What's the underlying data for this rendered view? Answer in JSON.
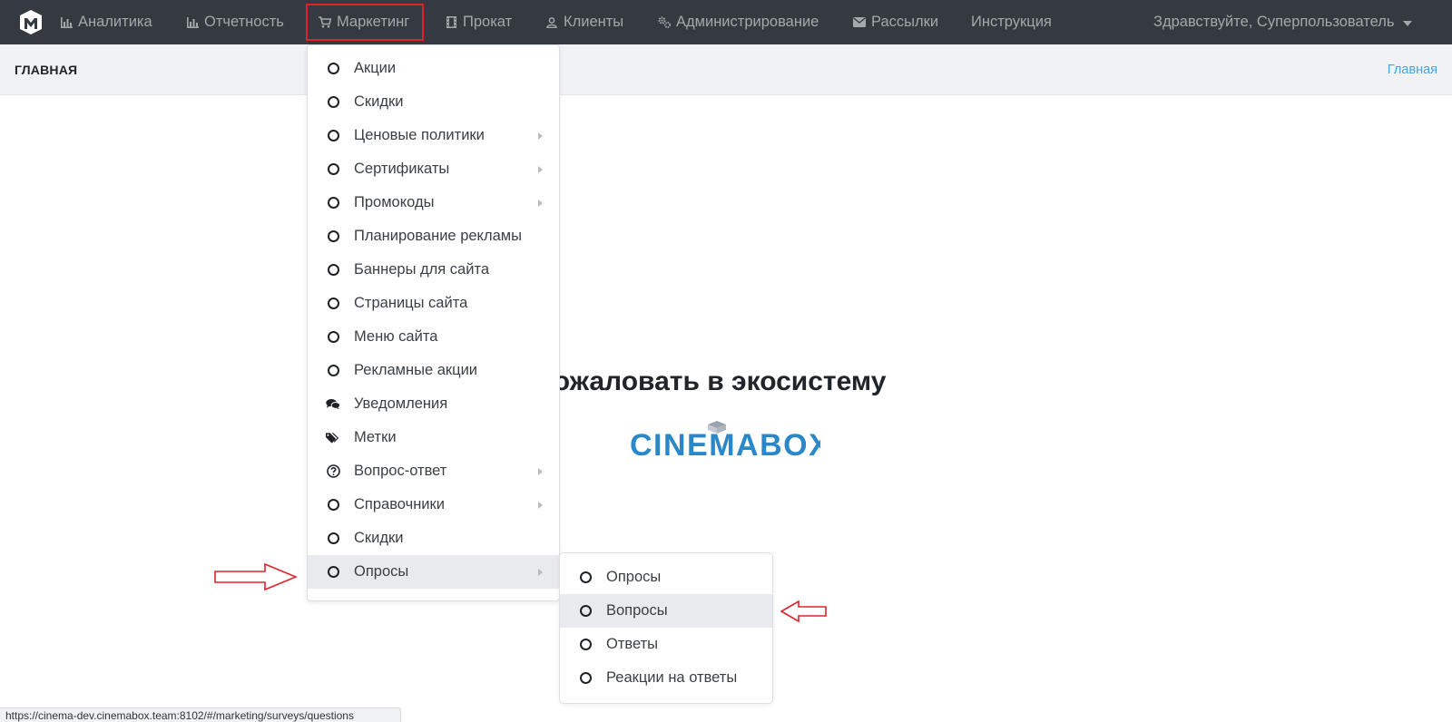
{
  "navbar": {
    "items": [
      {
        "label": "Аналитика",
        "icon": "bar-chart-icon"
      },
      {
        "label": "Отчетность",
        "icon": "bar-chart-icon"
      },
      {
        "label": "Маркетинг",
        "icon": "cart-icon"
      },
      {
        "label": "Прокат",
        "icon": "film-icon"
      },
      {
        "label": "Клиенты",
        "icon": "user-icon"
      },
      {
        "label": "Администрирование",
        "icon": "gears-icon"
      },
      {
        "label": "Рассылки",
        "icon": "envelope-icon"
      },
      {
        "label": "Инструкция",
        "icon": ""
      }
    ],
    "user_greeting": "Здравствуйте, Суперпользователь",
    "active_highlight_color": "#e0232b"
  },
  "header": {
    "title": "ГЛАВНАЯ",
    "breadcrumb": "Главная"
  },
  "main": {
    "welcome_text": "...о пожаловать в экосистему",
    "brand": "CINEMABOX"
  },
  "marketing_menu": {
    "items": [
      {
        "label": "Акции",
        "icon": "circle-icon",
        "submenu": false
      },
      {
        "label": "Скидки",
        "icon": "circle-icon",
        "submenu": false
      },
      {
        "label": "Ценовые политики",
        "icon": "circle-icon",
        "submenu": true
      },
      {
        "label": "Сертификаты",
        "icon": "circle-icon",
        "submenu": true
      },
      {
        "label": "Промокоды",
        "icon": "circle-icon",
        "submenu": true
      },
      {
        "label": "Планирование рекламы",
        "icon": "circle-icon",
        "submenu": false
      },
      {
        "label": "Баннеры для сайта",
        "icon": "circle-icon",
        "submenu": false
      },
      {
        "label": "Страницы сайта",
        "icon": "circle-icon",
        "submenu": false
      },
      {
        "label": "Меню сайта",
        "icon": "circle-icon",
        "submenu": false
      },
      {
        "label": "Рекламные акции",
        "icon": "circle-icon",
        "submenu": false
      },
      {
        "label": "Уведомления",
        "icon": "comments-icon",
        "submenu": false
      },
      {
        "label": "Метки",
        "icon": "tags-icon",
        "submenu": false
      },
      {
        "label": "Вопрос-ответ",
        "icon": "question-circle-icon",
        "submenu": true
      },
      {
        "label": "Справочники",
        "icon": "circle-icon",
        "submenu": true
      },
      {
        "label": "Скидки",
        "icon": "circle-icon",
        "submenu": false
      },
      {
        "label": "Опросы",
        "icon": "circle-icon",
        "submenu": true,
        "highlighted": true
      }
    ]
  },
  "surveys_submenu": {
    "items": [
      {
        "label": "Опросы",
        "highlighted": false
      },
      {
        "label": "Вопросы",
        "highlighted": true
      },
      {
        "label": "Ответы",
        "highlighted": false
      },
      {
        "label": "Реакции на ответы",
        "highlighted": false
      }
    ]
  },
  "status_bar": {
    "url": "https://cinema-dev.cinemabox.team:8102/#/marketing/surveys/questions"
  }
}
